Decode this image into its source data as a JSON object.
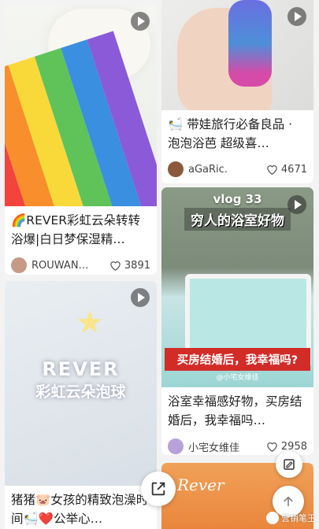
{
  "feed": {
    "cards": [
      {
        "title": "🌈REVER彩虹云朵转转浴爆|白日梦保湿精…",
        "author": "ROUWAN…",
        "likes": "3891",
        "avatar_color": "#c79a86",
        "is_video": true
      },
      {
        "title": "🛀 带娃旅行必备良品 · 泡泡浴芭 超级喜…",
        "author": "aGaRic.",
        "likes": "4671",
        "avatar_color": "#8a5a3c",
        "is_video": true
      },
      {
        "title": "浴室幸福感好物，买房结婚后，我幸福吗…",
        "author": "小宅女维佳",
        "likes": "2958",
        "avatar_color": "#b8a0d8",
        "is_video": true,
        "overlay_tag": "vlog 33",
        "overlay_headline": "穷人的浴室好物",
        "overlay_caption": "买房结婚后，我幸福吗?",
        "overlay_watermark": "@小宅女维佳"
      },
      {
        "title": "猪猪🐷女孩的精致泡澡时间🛀❤️公举心…",
        "is_video": true,
        "overlay_text": "REVER",
        "overlay_subtext": "彩虹云朵泡球"
      },
      {
        "overlay_text": "Rever"
      }
    ]
  },
  "watermark": {
    "label": "营销笔王"
  },
  "colors": {
    "accent_red": "#d22c28",
    "bg": "#f3f3f3"
  },
  "icons": {
    "play": "play-icon",
    "heart": "heart-icon",
    "share": "share-icon",
    "edit": "edit-icon",
    "back_to_top": "arrow-up-icon"
  }
}
